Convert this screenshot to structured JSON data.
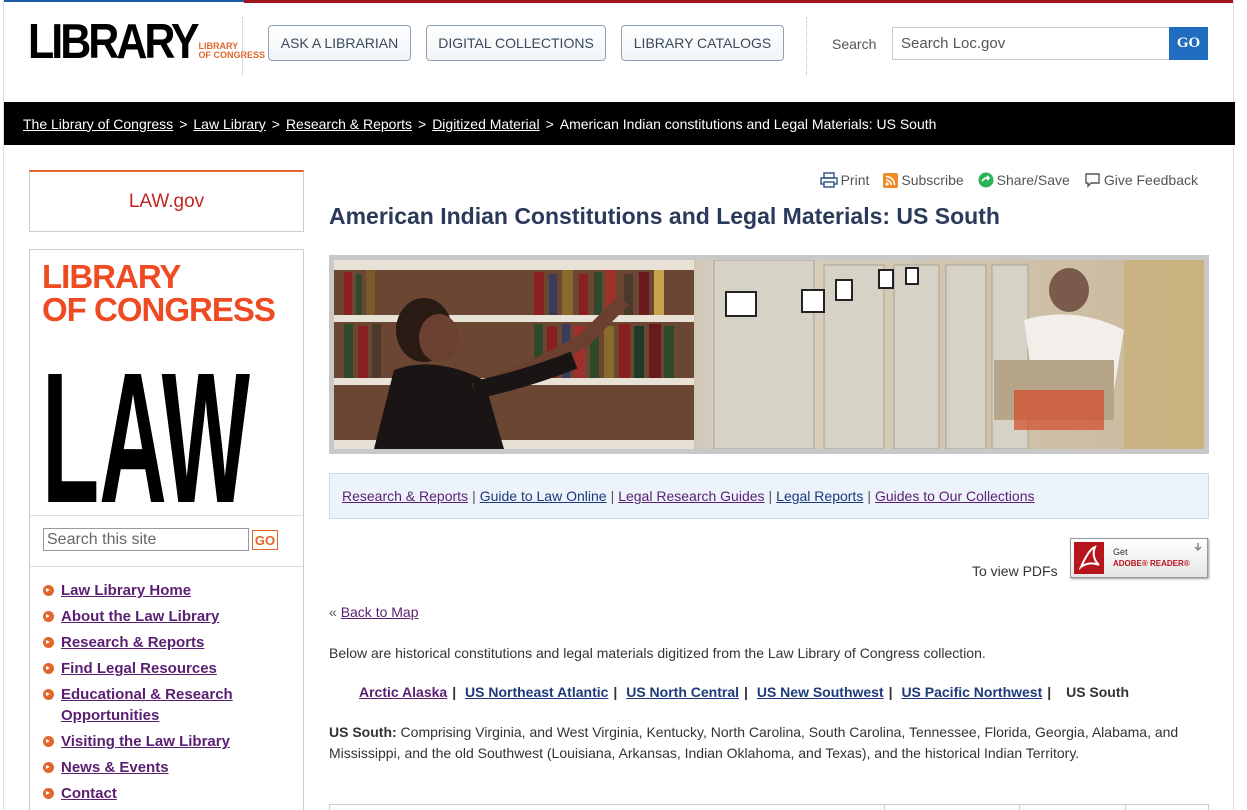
{
  "header": {
    "logo_word": "LIBRARY",
    "logo_sub_1": "LIBRARY",
    "logo_sub_2": "OF CONGRESS",
    "buttons": [
      "ASK A LIBRARIAN",
      "DIGITAL COLLECTIONS",
      "LIBRARY CATALOGS"
    ],
    "search_label": "Search",
    "search_placeholder": "Search Loc.gov",
    "search_go": "GO"
  },
  "breadcrumb": {
    "items": [
      "The Library of Congress",
      "Law Library",
      "Research & Reports",
      "Digitized Material"
    ],
    "current": "American Indian constitutions and Legal Materials: US South",
    "separator": ">"
  },
  "sidebar": {
    "lawgov": "LAW.gov",
    "lcl_line1": "LIBRARY",
    "lcl_line2": "OF CONGRESS",
    "lcl_law": "LAW",
    "search_placeholder": "Search this site",
    "search_go": "GO",
    "nav": [
      "Law Library Home",
      "About the Law Library",
      "Research & Reports",
      "Find Legal Resources",
      "Educational & Research Opportunities",
      "Visiting the Law Library",
      "News & Events",
      "Contact"
    ]
  },
  "tools": {
    "print": "Print",
    "subscribe": "Subscribe",
    "share": "Share/Save",
    "feedback": "Give Feedback"
  },
  "main": {
    "title": "American Indian Constitutions and Legal Materials: US South",
    "subnav": [
      "Research & Reports",
      "Guide to Law Online",
      "Legal Research Guides",
      "Legal Reports",
      "Guides to Our Collections"
    ],
    "pdf_label": "To view PDFs",
    "adobe_get": "Get",
    "adobe_reader": "ADOBE® READER®",
    "back_arrow": "«",
    "back_link": "Back to Map",
    "intro": "Below are historical constitutions and legal materials digitized from the Law Library of Congress collection.",
    "regions": [
      "Arctic Alaska",
      "US Northeast Atlantic",
      "US North Central",
      "US New Southwest",
      "US Pacific Northwest"
    ],
    "current_region": "US South",
    "desc_label": "US South:",
    "desc_text": " Comprising Virginia, and West Virginia, Kentucky, North Carolina, South Carolina, Tennessee, Florida, Georgia, Alabama, and Mississippi, and the old Southwest (Louisiana, Arkansas, Indian Oklahoma, and Texas), and the historical Indian Territory."
  },
  "colors": {
    "brand_orange": "#e2652b",
    "brand_red": "#a3171c",
    "link_visited": "#5a1f72",
    "link_blue": "#1d3a7a",
    "go_blue": "#1f6cc0"
  }
}
